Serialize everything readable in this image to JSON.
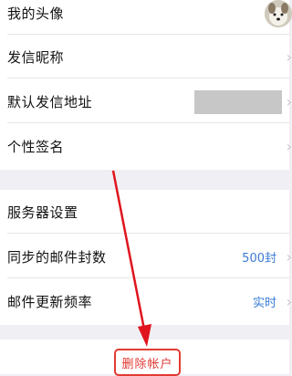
{
  "account": {
    "avatar_label": "我的头像",
    "nickname_label": "发信昵称",
    "default_address_label": "默认发信地址",
    "signature_label": "个性签名"
  },
  "server": {
    "settings_label": "服务器设置",
    "sync_count_label": "同步的邮件封数",
    "sync_count_value": "500封",
    "update_freq_label": "邮件更新频率",
    "update_freq_value": "实时"
  },
  "actions": {
    "delete_account_label": "删除帐户"
  },
  "colors": {
    "accent_blue": "#3a7bd5",
    "danger_red": "#e23a33",
    "annotation_red": "#e0141e"
  },
  "icons": [
    "chevron-right-icon",
    "avatar-image"
  ]
}
